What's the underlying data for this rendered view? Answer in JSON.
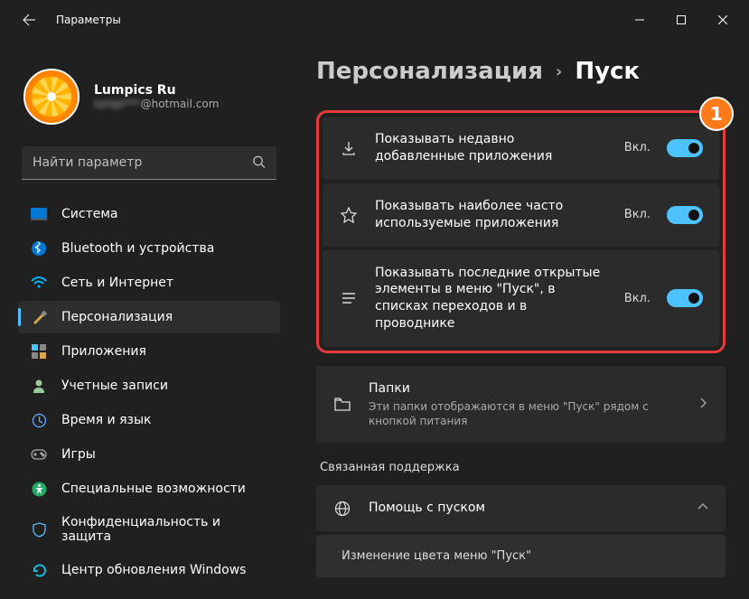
{
  "titlebar": {
    "title": "Параметры"
  },
  "profile": {
    "name": "Lumpics Ru",
    "email_blur": "lumpi***",
    "email_suffix": "@hotmail.com"
  },
  "search": {
    "placeholder": "Найти параметр"
  },
  "nav": [
    {
      "label": "Система"
    },
    {
      "label": "Bluetooth и устройства"
    },
    {
      "label": "Сеть и Интернет"
    },
    {
      "label": "Персонализация"
    },
    {
      "label": "Приложения"
    },
    {
      "label": "Учетные записи"
    },
    {
      "label": "Время и язык"
    },
    {
      "label": "Игры"
    },
    {
      "label": "Специальные возможности"
    },
    {
      "label": "Конфиденциальность и защита"
    },
    {
      "label": "Центр обновления Windows"
    }
  ],
  "breadcrumb": {
    "parent": "Персонализация",
    "current": "Пуск"
  },
  "annotation": {
    "badge": "1"
  },
  "toggles": [
    {
      "label": "Показывать недавно добавленные приложения",
      "state": "Вкл."
    },
    {
      "label": "Показывать наиболее часто используемые приложения",
      "state": "Вкл."
    },
    {
      "label": "Показывать последние открытые элементы в меню \"Пуск\", в списках переходов и в проводнике",
      "state": "Вкл."
    }
  ],
  "folders": {
    "title": "Папки",
    "subtitle": "Эти папки отображаются в меню \"Пуск\" рядом с кнопкой питания"
  },
  "support": {
    "section": "Связанная поддержка",
    "help": "Помощь с пуском",
    "sub": "Изменение цвета меню \"Пуск\""
  }
}
